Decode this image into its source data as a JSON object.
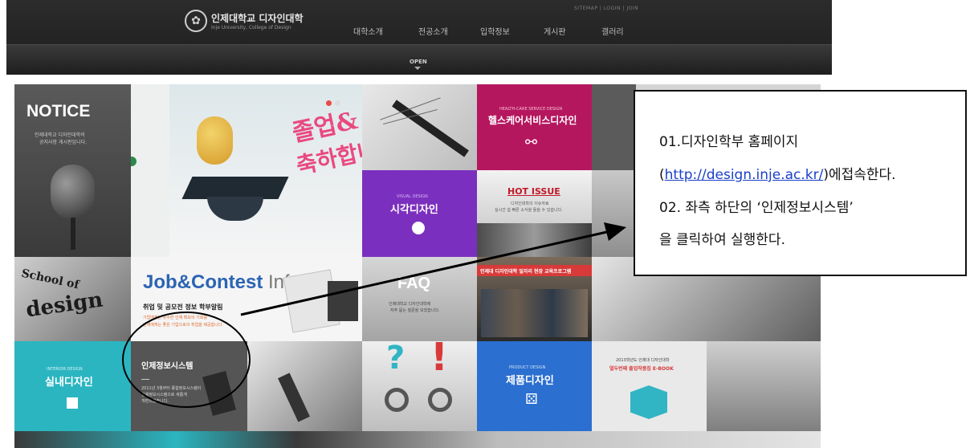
{
  "header": {
    "logo_title": "인제대학교 디자인대학",
    "logo_subtitle": "Inje University, College of Design",
    "util_links": "SITEMAP  |  LOGIN  |  JOIN",
    "nav": [
      "대학소개",
      "전공소개",
      "입학정보",
      "게시판",
      "갤러리"
    ],
    "open_label": "OPEN"
  },
  "tiles": {
    "notice_title": "NOTICE",
    "notice_desc_1": "인제대학교 디자인대학의",
    "notice_desc_2": "공지사항 게시판입니다.",
    "grad_text_1": "졸업&",
    "grad_text_2": "축하합니",
    "healthcare_small": "HEALTH-CARE SERVICE DESIGN",
    "healthcare_title": "헬스케어서비스디자인",
    "visual_small": "VISUAL DESIGN",
    "visual_title": "시각디자인",
    "hot_issue": "HOT ISSUE",
    "hot_desc_1": "디자인대학의 이슈자료",
    "hot_desc_2": "실시간 쉽 빠른 소식을 들을 수 있습니다.",
    "school_text_1": "School of",
    "school_text_2": "design",
    "job_title_1": "Job&Contest",
    "job_title_2": " Info",
    "job_sub": "취업 및 공모전 정보 학부알림",
    "job_desc_1": "기업에게는 유수한 인재 확보의 기회를",
    "job_desc_2": "인재에게는 좋은 기업으로의 취업을 제공합니다.",
    "faq_title": "FAQ",
    "faq_desc_1": "인제대학교 디자인대학에",
    "faq_desc_2": "자주 묻는 질문을 모았습니다.",
    "photo_banner": "인제대 디자인대학 일자리 현장 교육프로그램",
    "interior_small": "INTERIOR DESIGN",
    "interior_title": "실내디자인",
    "info_system_title": "인제정보시스템",
    "info_system_desc_1": "2011년 3월부터 종합정보시스템이",
    "info_system_desc_2": "인제정보시스템으로 새롭게",
    "info_system_desc_3": "개편되었습니다.",
    "product_small": "PRODUCT DESIGN",
    "product_title": "제품디자인",
    "ebook_line_1": "2013학년도 인제대 디자인대학",
    "ebook_line_2": "열두번째 졸업작품집 E-BOOK"
  },
  "annotation": {
    "line1": "01.디자인학부  홈페이지",
    "line2_open": "(",
    "line2_link": "http://design.inje.ac.kr/",
    "line2_close": ")에접속한다.",
    "line3": "02.  좌측  하단의  ‘인제정보시스템’",
    "line4": "을  클릭하여  실행한다."
  },
  "colors": {
    "header_bg": "#262626",
    "purple": "#7b2fbf",
    "magenta": "#b3175e",
    "teal": "#2bb5c0",
    "blue": "#2b6fd0",
    "link": "#1a3fc9"
  }
}
